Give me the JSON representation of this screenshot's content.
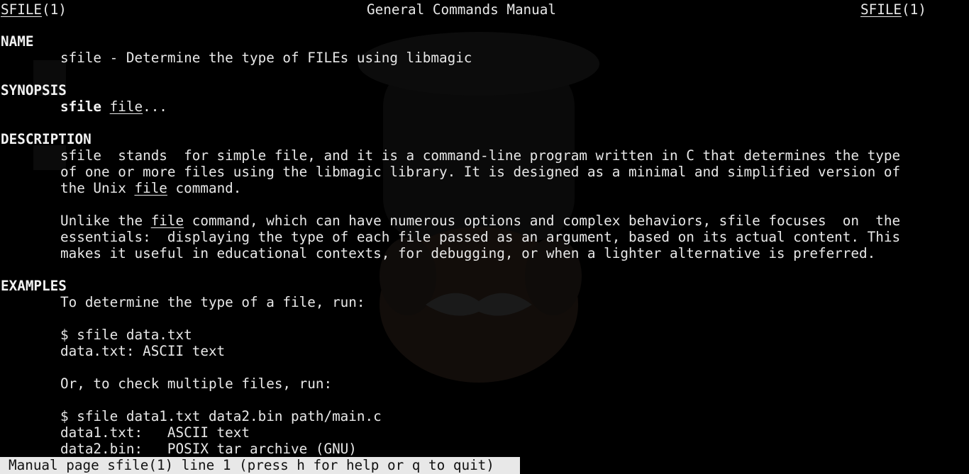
{
  "colors": {
    "background": "#000000",
    "text": "#e8e8e8",
    "status_bg": "#e8e8e8",
    "status_text": "#111111"
  },
  "header": {
    "left": "SFILE",
    "left_suffix": "(1)",
    "center": "General Commands Manual",
    "right": "SFILE",
    "right_suffix": "(1)"
  },
  "sections": {
    "name": {
      "heading": "NAME",
      "text": "sfile - Determine the type of FILEs using libmagic"
    },
    "synopsis": {
      "heading": "SYNOPSIS",
      "command": "sfile",
      "arg": "file",
      "ellipsis": "..."
    },
    "description": {
      "heading": "DESCRIPTION",
      "p1_l1": "sfile  stands  for simple file, and it is a command-line program written in C that determines the type",
      "p1_l2": "of one or more files using the libmagic library. It is designed as a minimal and simplified version of",
      "p1_l3_a": "the Unix ",
      "p1_l3_u": "file",
      "p1_l3_b": " command.",
      "p2_l1_a": "Unlike the ",
      "p2_l1_u": "file",
      "p2_l1_b": " command, which can have numerous options and complex behaviors, sfile focuses  on  the",
      "p2_l2": "essentials:  displaying the type of each file passed as an argument, based on its actual content. This",
      "p2_l3": "makes it useful in educational contexts, for debugging, or when a lighter alternative is preferred."
    },
    "examples": {
      "heading": "EXAMPLES",
      "l1": "To determine the type of a file, run:",
      "l2": "$ sfile data.txt",
      "l3": "data.txt: ASCII text",
      "l4": "Or, to check multiple files, run:",
      "l5": "$ sfile data1.txt data2.bin path/main.c",
      "l6": "data1.txt:   ASCII text",
      "l7": "data2.bin:   POSIX tar archive (GNU)"
    }
  },
  "status_bar": "Manual page sfile(1) line 1 (press h for help or q to quit)"
}
